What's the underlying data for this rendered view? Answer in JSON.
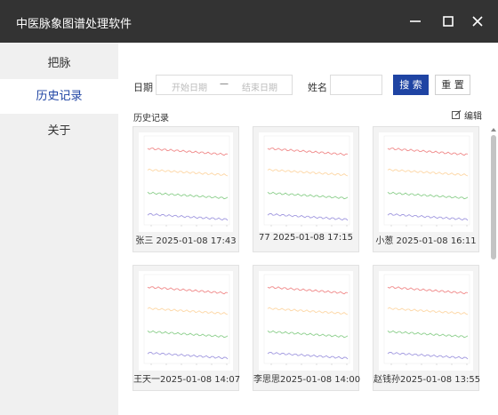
{
  "window": {
    "title": "中医脉象图谱处理软件"
  },
  "sidebar": {
    "items": [
      {
        "label": "把脉"
      },
      {
        "label": "历史记录"
      },
      {
        "label": "关于"
      }
    ]
  },
  "filters": {
    "date_label": "日期",
    "start_placeholder": "开始日期",
    "separator": "—",
    "end_placeholder": "结束日期",
    "name_label": "姓名",
    "name_value": "",
    "search_button": "搜 索",
    "reset_button": "重 置"
  },
  "history": {
    "section_label": "历史记录",
    "edit_label": "编辑",
    "records": [
      {
        "caption": "张三 2025-01-08 17:43"
      },
      {
        "caption": "77 2025-01-08 17:15"
      },
      {
        "caption": "小葱 2025-01-08 16:11"
      },
      {
        "caption": "王天一2025-01-08 14:07"
      },
      {
        "caption": "李思思2025-01-08 14:00"
      },
      {
        "caption": "赵钱孙2025-01-08 13:55"
      }
    ]
  },
  "colors": {
    "primary": "#1f44a3",
    "titlebar": "#333333",
    "sidebar": "#f0f0f0",
    "wave_red": "#f08a8a",
    "wave_orange": "#fdd7a6",
    "wave_green": "#8ccf8c",
    "wave_purple": "#a39be0"
  }
}
